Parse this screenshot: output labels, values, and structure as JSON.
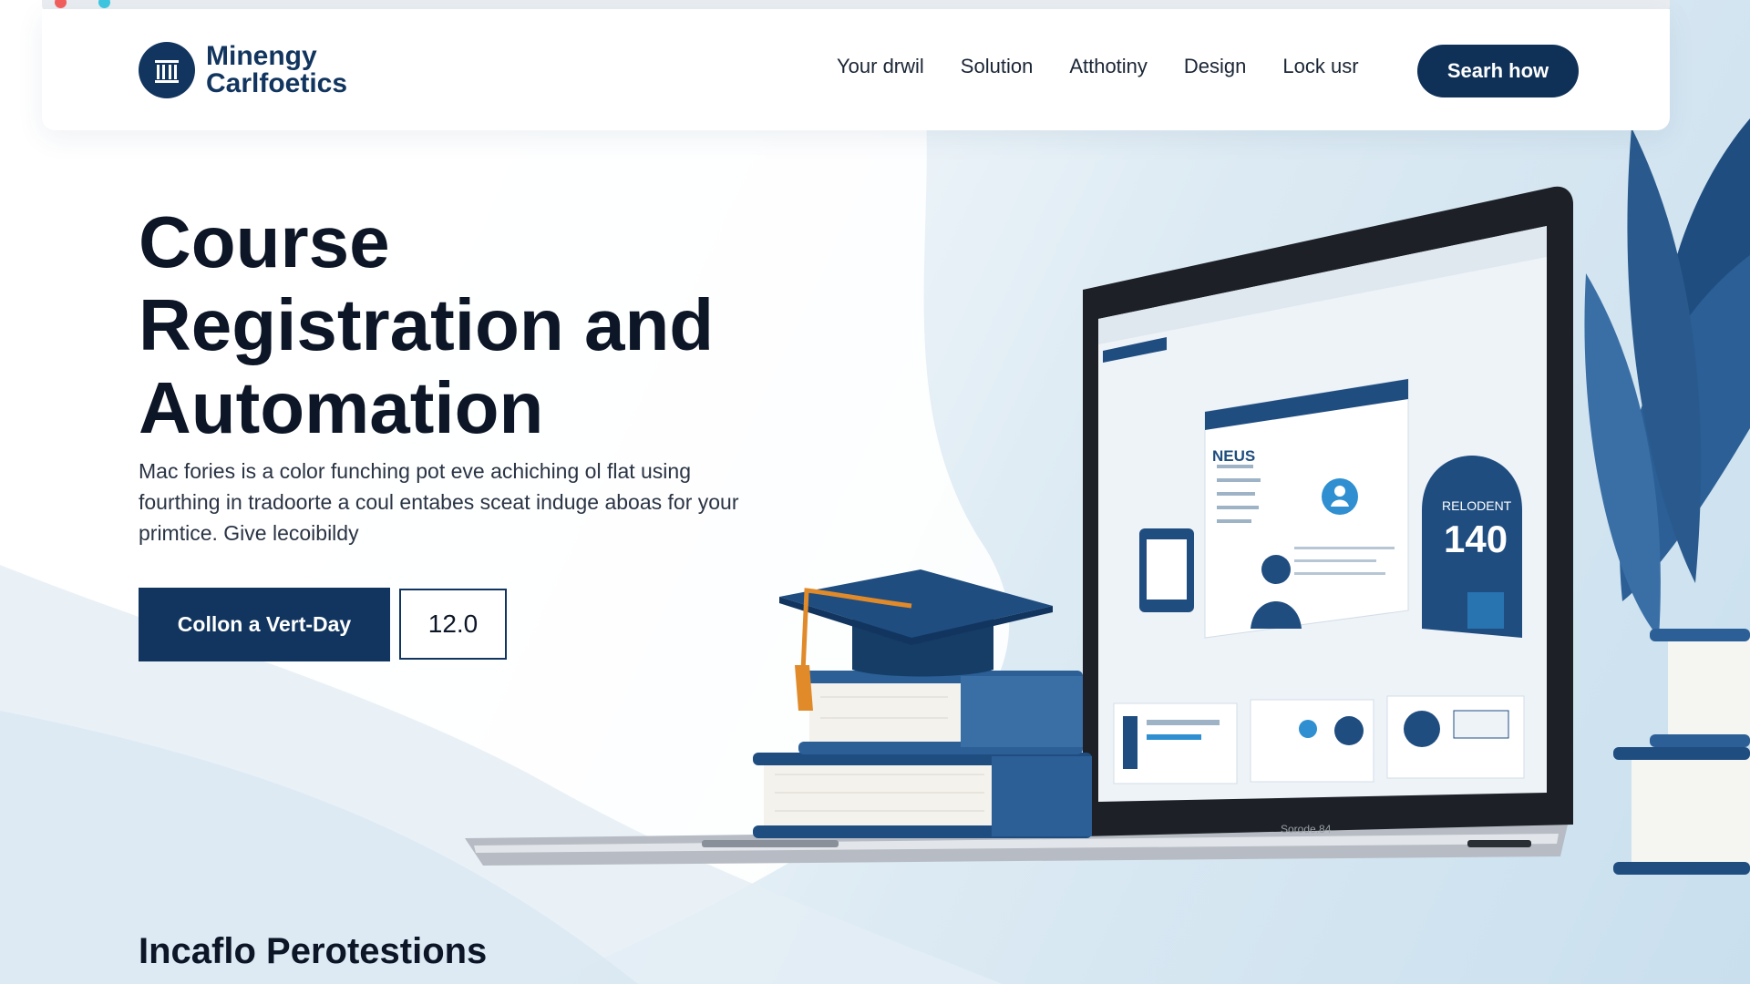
{
  "brand": {
    "line1": "Minengy",
    "line2": "Carlfoetics"
  },
  "nav": {
    "links": [
      "Your drwil",
      "Solution",
      "Atthotiny",
      "Design",
      "Lock usr"
    ],
    "cta": "Searh how"
  },
  "hero": {
    "title_lines": [
      "Course",
      "Registration and",
      "Automation"
    ],
    "description": "Mac fories is a color funching pot eve achiching ol flat using fourthing in tradoorte a coul entabes sceat induge aboas for your primtice. Give lecoibildy",
    "primary_button": "Collon a Vert-Day",
    "secondary_button": "12.0"
  },
  "laptop_screen": {
    "left_panel_label": "NEUS",
    "stat_label": "RELODENT",
    "stat_value": "140",
    "base_label": "Sorode.84"
  },
  "section": {
    "heading": "Incaflo Perotestions"
  },
  "colors": {
    "navy": "#12355f",
    "accent_blue": "#2f8fd0",
    "tassel": "#e08a2a"
  },
  "icons": [
    "logo-mark-icon",
    "graduation-cap-icon",
    "book-stack-icon",
    "laptop-icon",
    "plant-leaves-icon",
    "user-avatar-icon"
  ]
}
